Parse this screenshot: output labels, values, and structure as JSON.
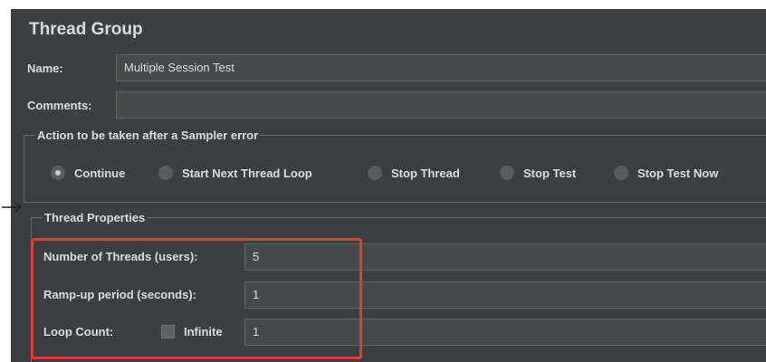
{
  "thread_group": {
    "title": "Thread Group",
    "name_label": "Name:",
    "name_value": "Multiple Session Test",
    "comments_label": "Comments:",
    "comments_value": "",
    "sampler_error": {
      "legend": "Action to be taken after a Sampler error",
      "options": [
        {
          "label": "Continue",
          "selected": true
        },
        {
          "label": "Start Next Thread Loop",
          "selected": false
        },
        {
          "label": "Stop Thread",
          "selected": false
        },
        {
          "label": "Stop Test",
          "selected": false
        },
        {
          "label": "Stop Test Now",
          "selected": false
        }
      ]
    },
    "thread_properties": {
      "legend": "Thread Properties",
      "threads_label": "Number of Threads (users):",
      "threads_value": "5",
      "rampup_label": "Ramp-up period (seconds):",
      "rampup_value": "1",
      "loop_label": "Loop Count:",
      "infinite_label": "Infinite",
      "infinite_checked": false,
      "loop_value": "1"
    }
  },
  "colors": {
    "background": "#3c3f41",
    "field": "#45494a",
    "text": "#dcdcdc",
    "highlight": "#e03c3c"
  },
  "icons": [
    "arrow-right-icon",
    "radio-icon",
    "checkbox-icon"
  ]
}
